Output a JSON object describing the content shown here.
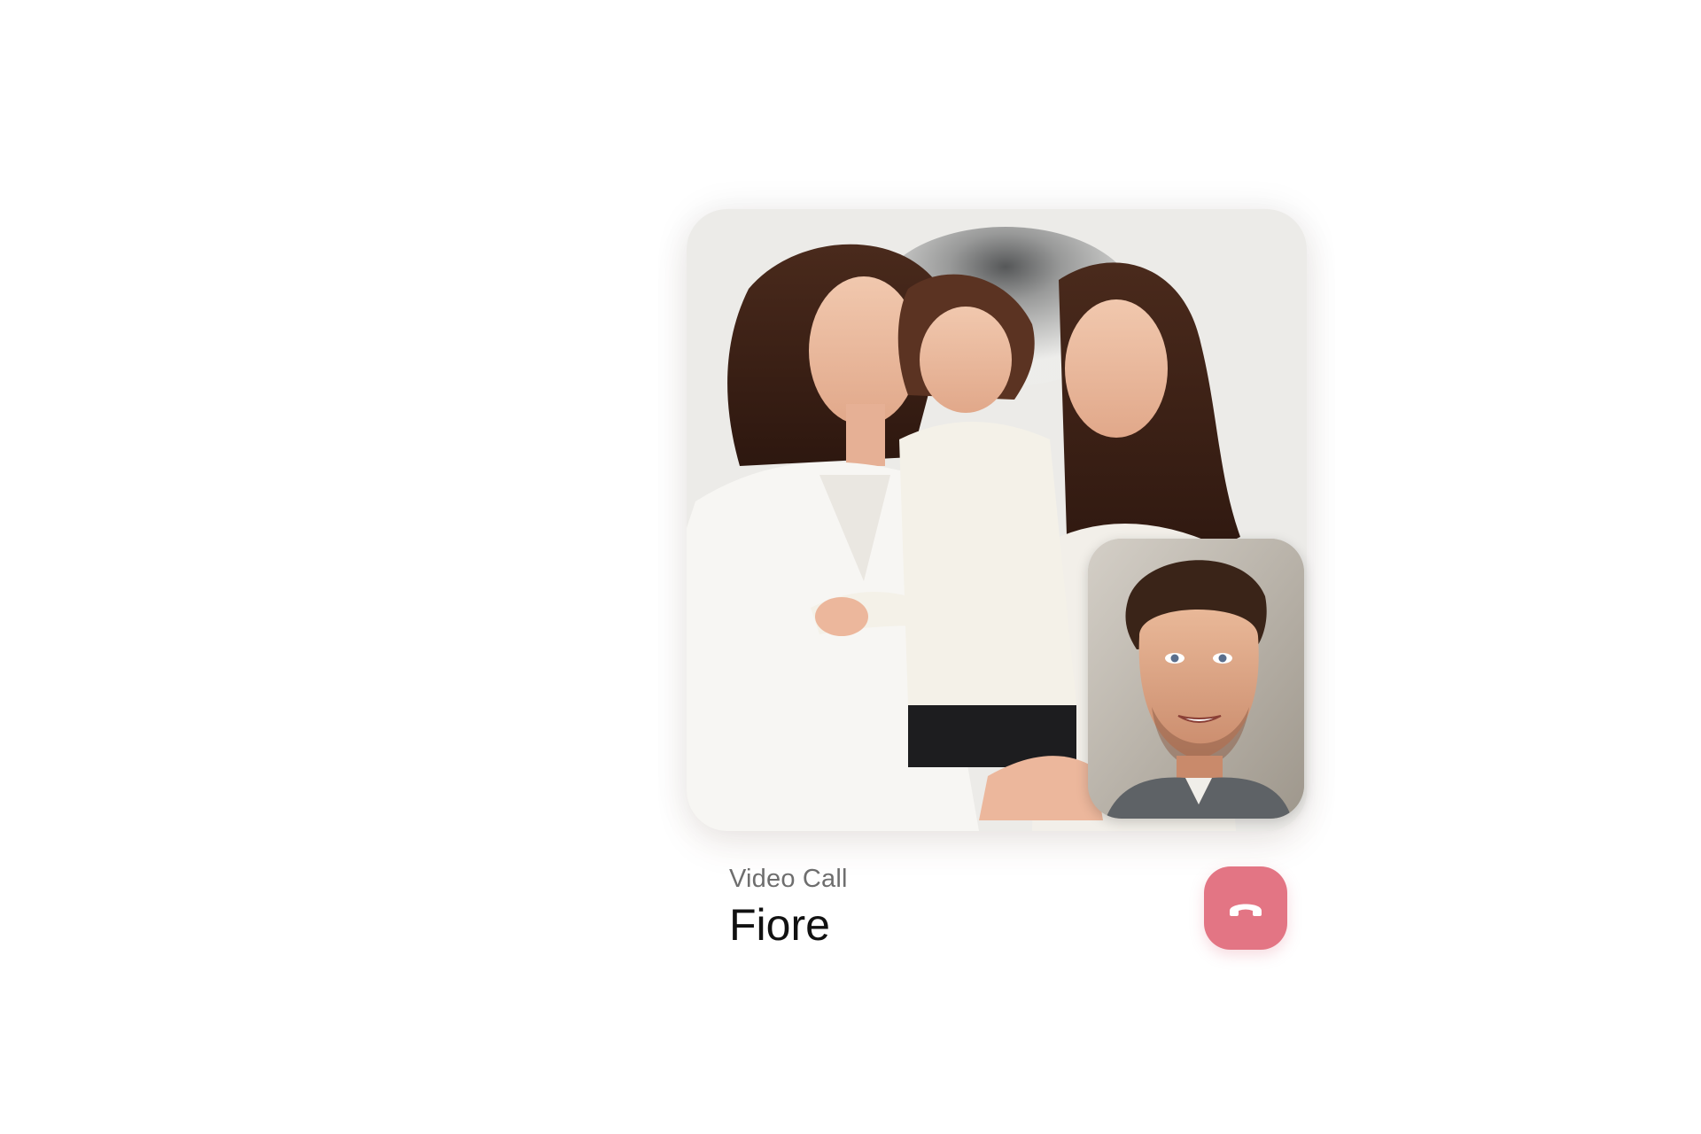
{
  "call": {
    "type_label": "Video Call",
    "contact_name": "Fiore"
  },
  "controls": {
    "end_call_icon": "phone-hangup-icon"
  },
  "colors": {
    "end_call_bg": "#e37584",
    "end_call_icon": "#ffffff",
    "label_text": "#6e6e6e",
    "name_text": "#111111"
  }
}
